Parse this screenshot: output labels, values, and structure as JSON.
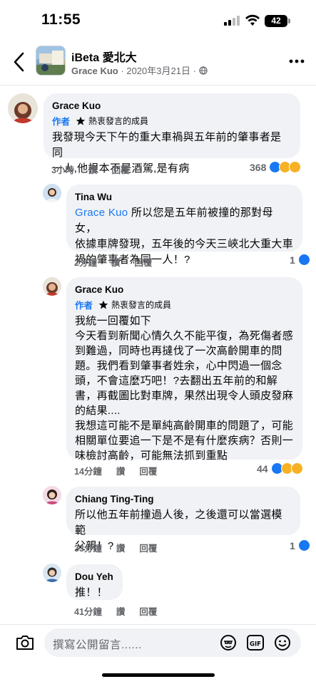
{
  "status_bar": {
    "time": "11:55",
    "battery": "42"
  },
  "header": {
    "group_name": "iBeta 愛北大",
    "author": "Grace Kuo",
    "date": "2020年3月21日",
    "visibility_sep": "·"
  },
  "comments": [
    {
      "name": "Grace Kuo",
      "author_badge": "作者",
      "member_badge": "熱衷發言的成員",
      "lines": [
        "我發現今天下午的重大車禍與五年前的肇事者是同",
        "一人,他根本不是酒駕,是有病"
      ],
      "time": "3小時",
      "like_label": "讚",
      "reply_label": "回覆",
      "reaction_count": "368"
    },
    {
      "name": "Tina Wu",
      "mention": "Grace Kuo",
      "lines": [
        " 所以您是五年前被撞的那對母女，",
        "依據車牌發現，五年後的今天三峽北大重大車",
        "禍的肇事者為同一人！?"
      ],
      "time": "2分鐘",
      "like_label": "讚",
      "reply_label": "回覆",
      "reaction_count": "1"
    },
    {
      "name": "Grace Kuo",
      "author_badge": "作者",
      "member_badge": "熱衷發言的成員",
      "lines": [
        "我統一回覆如下",
        "今天看到新聞心情久久不能平復，為死傷者感",
        "到難過，同時也再撻伐了一次高齡開車的問",
        "題。我們看到肇事者姓余，心中閃過一個念",
        "頭，不會這麼巧吧！?去翻出五年前的和解",
        "書，再截圖比對車牌，果然出現令人頭皮發麻",
        "的結果....",
        "我想這可能不是單純高齡開車的問題了，可能",
        "相關單位要追一下是不是有什麼疾病？否則一",
        "味檢討高齡，可能無法抓到重點"
      ],
      "time": "14分鐘",
      "like_label": "讚",
      "reply_label": "回覆",
      "reaction_count": "44"
    },
    {
      "name": "Chiang Ting-Ting",
      "lines": [
        "所以他五年前撞過人後，之後還可以當選模範",
        "父親！?"
      ],
      "time": "33分鐘",
      "like_label": "讚",
      "reply_label": "回覆",
      "reaction_count": "1"
    },
    {
      "name": "Dou Yeh",
      "lines": [
        "推！！"
      ],
      "time": "41分鐘",
      "like_label": "讚",
      "reply_label": "回覆"
    }
  ],
  "composer": {
    "placeholder": "撰寫公開留言......"
  },
  "icons": {
    "back": "chevron-left-icon",
    "more": "more-dots-icon",
    "camera": "camera-icon",
    "sticker": "sticker-icon",
    "gif": "gif-icon",
    "emoji": "emoji-icon"
  }
}
